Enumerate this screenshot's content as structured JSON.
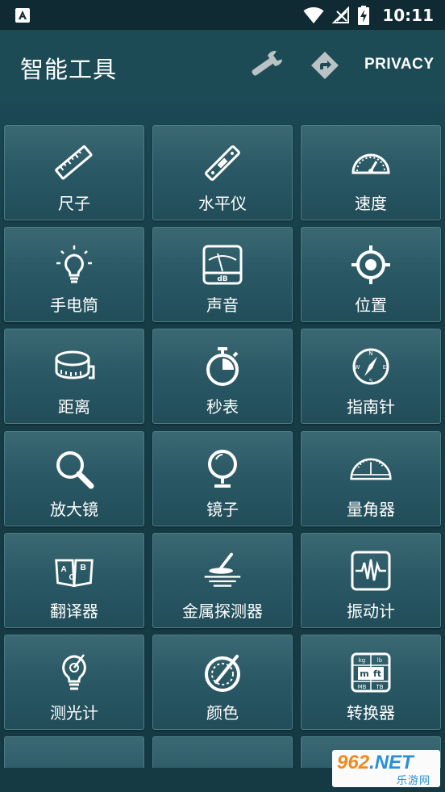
{
  "status_bar": {
    "time": "10:11"
  },
  "app_bar": {
    "title": "智能工具",
    "privacy_label": "PRIVACY"
  },
  "tools": [
    {
      "label": "尺子",
      "icon": "ruler-icon"
    },
    {
      "label": "水平仪",
      "icon": "spirit-level-icon"
    },
    {
      "label": "速度",
      "icon": "speedometer-icon"
    },
    {
      "label": "手电筒",
      "icon": "lightbulb-icon"
    },
    {
      "label": "声音",
      "icon": "decibel-meter-icon"
    },
    {
      "label": "位置",
      "icon": "location-target-icon"
    },
    {
      "label": "距离",
      "icon": "tape-measure-icon"
    },
    {
      "label": "秒表",
      "icon": "stopwatch-icon"
    },
    {
      "label": "指南针",
      "icon": "compass-icon"
    },
    {
      "label": "放大镜",
      "icon": "magnifier-icon"
    },
    {
      "label": "镜子",
      "icon": "mirror-icon"
    },
    {
      "label": "量角器",
      "icon": "protractor-icon"
    },
    {
      "label": "翻译器",
      "icon": "translator-book-icon"
    },
    {
      "label": "金属探测器",
      "icon": "metal-detector-icon"
    },
    {
      "label": "振动计",
      "icon": "vibration-meter-icon"
    },
    {
      "label": "测光计",
      "icon": "light-meter-icon"
    },
    {
      "label": "颜色",
      "icon": "color-palette-icon"
    },
    {
      "label": "转换器",
      "icon": "unit-converter-icon"
    }
  ],
  "watermark": {
    "main_number": "962",
    "main_suffix": ".NET",
    "sub_text": "乐游网"
  },
  "colors": {
    "background": "#163a44",
    "app_bar": "#1c4b56",
    "tile": "#2a5965",
    "text": "#ffffff"
  }
}
